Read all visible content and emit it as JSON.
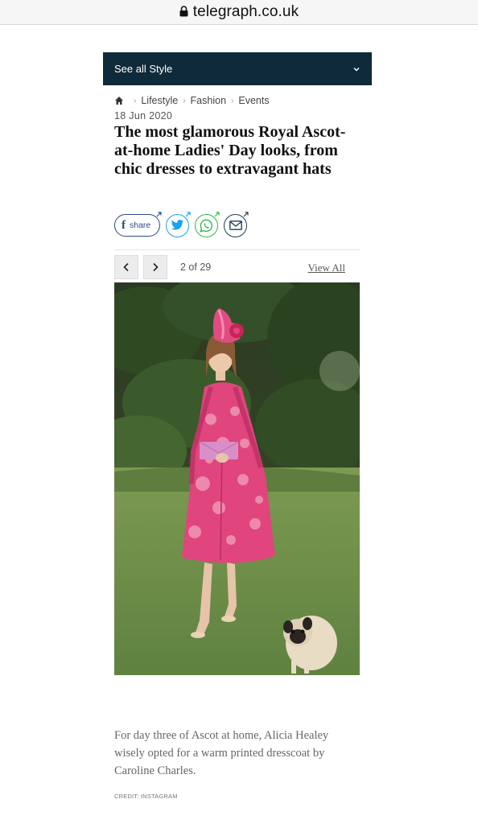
{
  "browser": {
    "url": "telegraph.co.uk"
  },
  "section_nav": {
    "label": "See all Style"
  },
  "breadcrumb": {
    "items": [
      "Lifestyle",
      "Fashion",
      "Events"
    ]
  },
  "article": {
    "date": "18 Jun 2020",
    "headline": "The most glamorous Royal Ascot-at-home Ladies' Day looks, from chic dresses to extravagant hats"
  },
  "share": {
    "facebook_label": "share"
  },
  "gallery": {
    "counter": "2 of 29",
    "view_all": "View All",
    "caption": "For day three of Ascot at home, Alicia Healey wisely opted for a warm printed dresscoat by Caroline Charles.",
    "credit": "CREDIT: INSTAGRAM"
  },
  "colors": {
    "nav_bg": "#0f2a3a",
    "facebook": "#2c4a8a",
    "twitter": "#1da1f2",
    "whatsapp": "#2fb64a",
    "email": "#1f3f55"
  },
  "icons": [
    "lock-icon",
    "chevron-down-icon",
    "home-icon",
    "facebook-icon",
    "twitter-icon",
    "whatsapp-icon",
    "email-icon",
    "chevron-left-icon",
    "chevron-right-icon"
  ]
}
